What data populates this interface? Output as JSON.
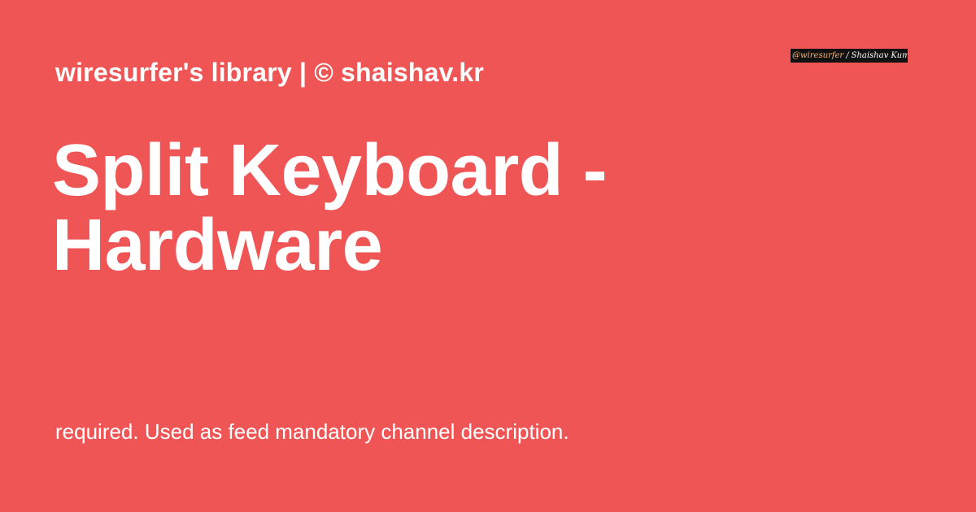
{
  "colors": {
    "background": "#ef5555",
    "text": "#ffffff",
    "badge_background": "#111111",
    "badge_handle": "#ffb36a"
  },
  "header": {
    "site_line": "wiresurfer's library | © shaishav.kr"
  },
  "badge": {
    "handle": "@wiresurfer",
    "separator": "/",
    "author": "Shaishav Kumar"
  },
  "title": {
    "line1": "Split Keyboard -",
    "line2": "Hardware"
  },
  "description": "required. Used as feed mandatory channel description."
}
